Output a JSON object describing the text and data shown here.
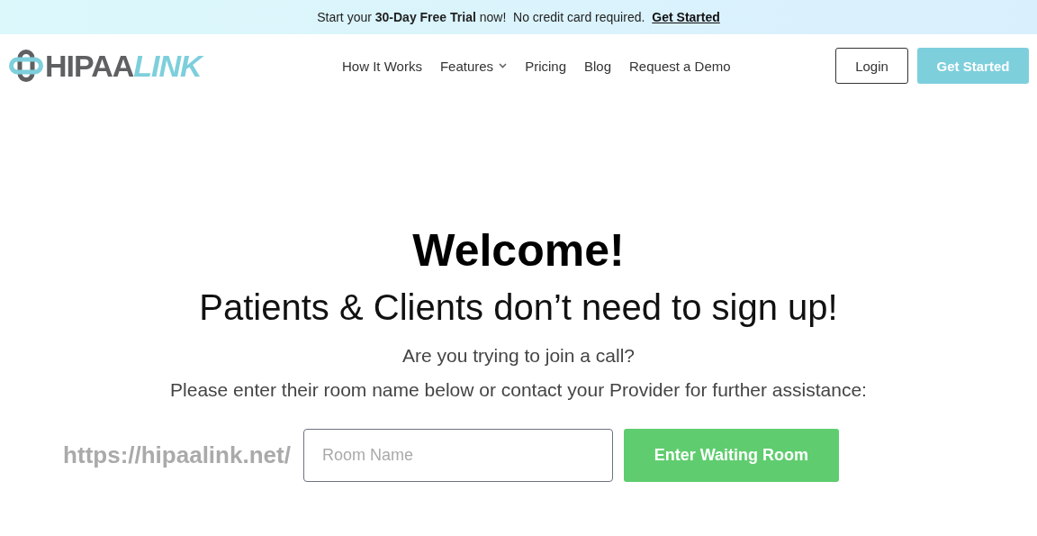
{
  "banner": {
    "text": "Start your **30-Day Free Trial** now!  No credit card required.",
    "link": "Get Started"
  },
  "header": {
    "logo": {
      "main": "HIPAA",
      "accent": "LINK"
    },
    "nav": [
      {
        "label": "How It Works",
        "dropdown": false
      },
      {
        "label": "Features",
        "dropdown": true
      },
      {
        "label": "Pricing",
        "dropdown": false
      },
      {
        "label": "Blog",
        "dropdown": false
      },
      {
        "label": "Request a Demo",
        "dropdown": false
      }
    ],
    "login_button": "Login",
    "cta_button": "Get Started"
  },
  "hero": {
    "title": "Welcome!",
    "subtitle": "Patients & Clients don’t need to sign up!",
    "question": "Are you trying to join a call?",
    "instructions": "Please enter their room name below or contact your Provider for further assistance:",
    "url_prefix": "https://hipaalink.net/",
    "room_field": {
      "placeholder": "Room Name"
    },
    "submit_button": "Enter Waiting Room"
  }
}
